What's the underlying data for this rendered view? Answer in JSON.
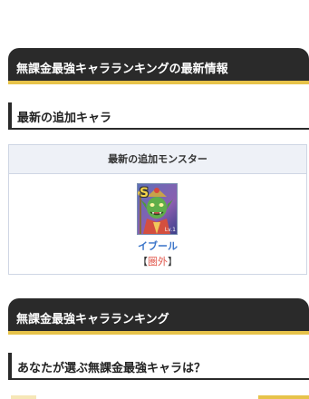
{
  "sections": {
    "latest_info": {
      "title": "無課金最強キャラランキングの最新情報"
    },
    "latest_added": {
      "title": "最新の追加キャラ"
    },
    "ranking": {
      "title": "無課金最強キャラランキング"
    },
    "vote": {
      "title": "あなたが選ぶ無課金最強キャラは？"
    }
  },
  "monster_box": {
    "header": "最新の追加モンスター",
    "monster": {
      "name": "イブール",
      "rank_badge": "S",
      "level_tag": "Lv.1",
      "status_open": "【",
      "status": "圏外",
      "status_close": "】",
      "icon": "monster-portrait-icon"
    }
  },
  "colors": {
    "bar_dark": "#2a2a2a",
    "accent_yellow": "#e7c34a",
    "link_blue": "#3a74c9",
    "status_red": "#e0554a"
  }
}
